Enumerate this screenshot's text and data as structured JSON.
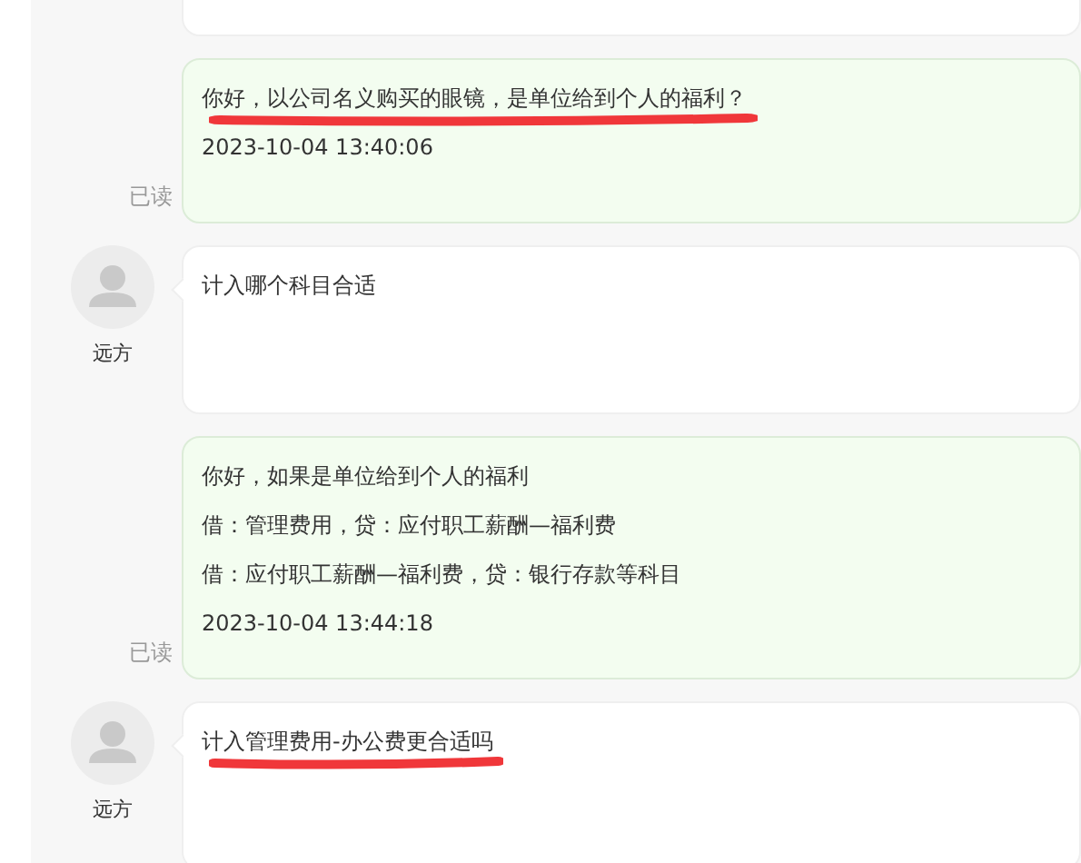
{
  "messages": [
    {
      "kind": "question",
      "cut_off": true
    },
    {
      "kind": "reply",
      "lines": [
        {
          "text": "你好，以公司名义购买的眼镜，是单位给到个人的福利？",
          "underlined": true
        }
      ],
      "time": "2023-10-04 13:40:06",
      "status": "已读"
    },
    {
      "kind": "question",
      "author": "远方",
      "lines": [
        {
          "text": "计入哪个科目合适",
          "underlined": false
        }
      ]
    },
    {
      "kind": "reply",
      "lines": [
        {
          "text": "你好，如果是单位给到个人的福利",
          "underlined": false
        },
        {
          "text": "借：管理费用，贷：应付职工薪酬—福利费",
          "underlined": false
        },
        {
          "text": "借：应付职工薪酬—福利费，贷：银行存款等科目",
          "underlined": false
        }
      ],
      "time": "2023-10-04 13:44:18",
      "status": "已读"
    },
    {
      "kind": "question",
      "author": "远方",
      "lines": [
        {
          "text": "计入管理费用-办公费更合适吗",
          "underlined": true
        }
      ]
    }
  ]
}
